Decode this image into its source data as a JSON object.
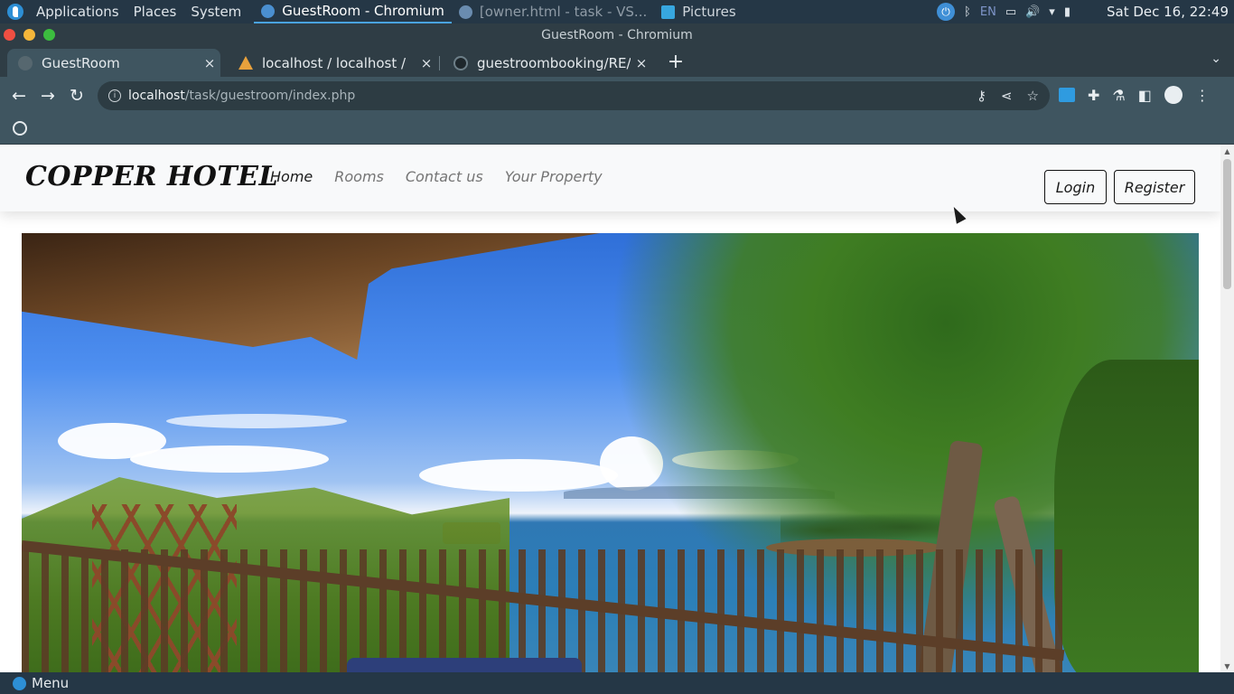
{
  "desktop_panel": {
    "menus": [
      "Applications",
      "Places",
      "System"
    ],
    "tasks": [
      {
        "label": "GuestRoom - Chromium",
        "icon": "chromium-icon"
      },
      {
        "label": "[owner.html - task - VS...",
        "icon": "vscode-icon"
      },
      {
        "label": "Pictures",
        "icon": "folder-icon"
      }
    ],
    "tray": {
      "lang": "EN",
      "clock": "Sat Dec 16, 22:49"
    }
  },
  "browser": {
    "window_title": "GuestRoom - Chromium",
    "tabs": [
      {
        "label": "GuestRoom",
        "close": "×"
      },
      {
        "label": "localhost / localhost /",
        "close": "×"
      },
      {
        "label": "guestroombooking/RE/",
        "close": "×"
      }
    ],
    "new_tab": "+",
    "url": {
      "host": "localhost",
      "path": "/task/guestroom/index.php"
    }
  },
  "page": {
    "brand": "COPPER HOTEL",
    "nav": [
      {
        "label": "Home",
        "active": true
      },
      {
        "label": "Rooms",
        "active": false
      },
      {
        "label": "Contact us",
        "active": false
      },
      {
        "label": "Your Property",
        "active": false
      }
    ],
    "login_label": "Login",
    "register_label": "Register"
  },
  "bottom_panel": {
    "menu_label": "Menu"
  },
  "colors": {
    "brand_text": "#111111",
    "nav_active": "#1b1b1b",
    "nav_inactive": "#757575",
    "navbar_bg": "#f8f9fa",
    "panel_bg": "#253746",
    "toolbar_bg": "#3f5560"
  }
}
